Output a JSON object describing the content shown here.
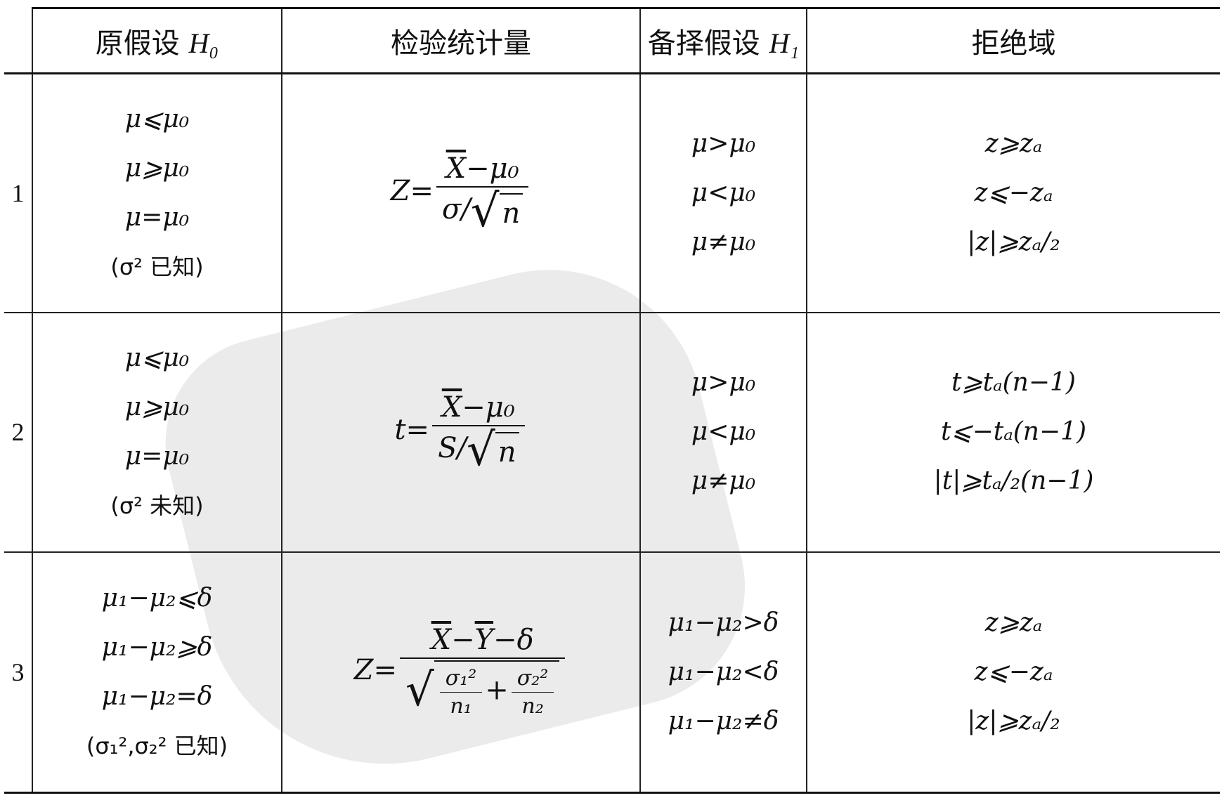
{
  "header": {
    "col_index": "",
    "h0_label": "原假设",
    "h0_symbol": "H₀",
    "statistic_label": "检验统计量",
    "h1_label": "备择假设",
    "h1_symbol": "H₁",
    "rejection_label": "拒绝域"
  },
  "rows": [
    {
      "index": "1",
      "h0": [
        "μ⩽μ₀",
        "μ⩾μ₀",
        "μ=μ₀"
      ],
      "h0_note": "(σ² 已知)",
      "statistic": {
        "lhs": "Z=",
        "num_bar": "X",
        "num_rest": "−μ₀",
        "den_pre": "σ/",
        "den_root": "n"
      },
      "h1": [
        "μ>μ₀",
        "μ<μ₀",
        "μ≠μ₀"
      ],
      "rejection": [
        "z⩾zₐ",
        "z⩽−zₐ",
        "|z|⩾zₐ/₂"
      ]
    },
    {
      "index": "2",
      "h0": [
        "μ⩽μ₀",
        "μ⩾μ₀",
        "μ=μ₀"
      ],
      "h0_note": "(σ² 未知)",
      "statistic": {
        "lhs": "t=",
        "num_bar": "X",
        "num_rest": "−μ₀",
        "den_pre": "S/",
        "den_root": "n"
      },
      "h1": [
        "μ>μ₀",
        "μ<μ₀",
        "μ≠μ₀"
      ],
      "rejection": [
        "t⩾tₐ(n−1)",
        "t⩽−tₐ(n−1)",
        "|t|⩾tₐ/₂(n−1)"
      ]
    },
    {
      "index": "3",
      "h0": [
        "μ₁−μ₂⩽δ",
        "μ₁−μ₂⩾δ",
        "μ₁−μ₂=δ"
      ],
      "h0_note": "(σ₁²,σ₂² 已知)",
      "statistic": {
        "lhs": "Z=",
        "num_bar1": "X",
        "num_mid": "−",
        "num_bar2": "Y",
        "num_rest": "−δ",
        "f1_num": "σ₁²",
        "f1_den": "n₁",
        "plus": "+",
        "f2_num": "σ₂²",
        "f2_den": "n₂"
      },
      "h1": [
        "μ₁−μ₂>δ",
        "μ₁−μ₂<δ",
        "μ₁−μ₂≠δ"
      ],
      "rejection": [
        "z⩾zₐ",
        "z⩽−zₐ",
        "|z|⩾zₐ/₂"
      ]
    }
  ]
}
